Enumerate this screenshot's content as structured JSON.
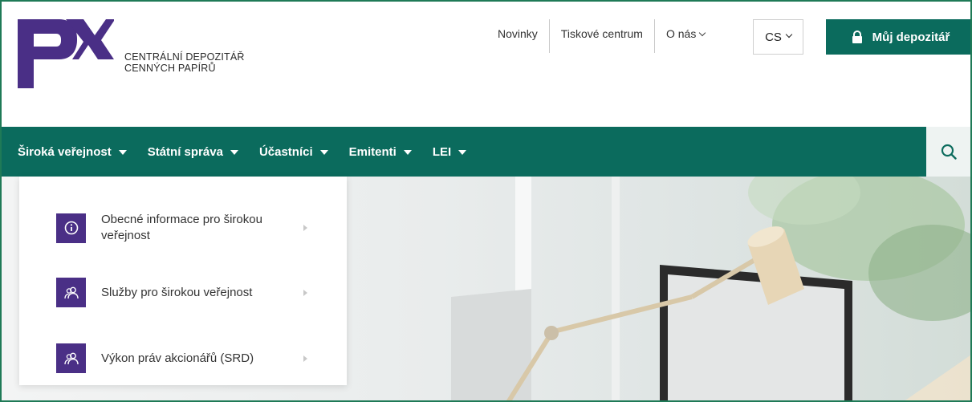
{
  "brand": {
    "line1": "CENTRÁLNÍ DEPOZITÁŘ",
    "line2": "CENNÝCH PAPÍRŮ",
    "logo_color": "#4a2f86"
  },
  "top_links": [
    {
      "label": "Novinky"
    },
    {
      "label": "Tiskové centrum"
    },
    {
      "label": "O nás"
    }
  ],
  "language": "CS",
  "depository_button": {
    "label": "Můj depozitář",
    "icon": "lock-icon"
  },
  "nav": {
    "items": [
      {
        "label": "Široká veřejnost"
      },
      {
        "label": "Státní správa"
      },
      {
        "label": "Účastníci"
      },
      {
        "label": "Emitenti"
      },
      {
        "label": "LEI"
      }
    ],
    "search_icon": "search-icon"
  },
  "dropdown": {
    "items": [
      {
        "label": "Obecné informace pro širokou veřejnost",
        "icon": "info-icon"
      },
      {
        "label": "Služby pro širokou veřejnost",
        "icon": "people-icon"
      },
      {
        "label": "Výkon práv akcionářů (SRD)",
        "icon": "people-icon"
      }
    ]
  },
  "colors": {
    "primary_green": "#0b6b5d",
    "frame_green": "#1f7a57",
    "icon_purple": "#4a2f86"
  }
}
